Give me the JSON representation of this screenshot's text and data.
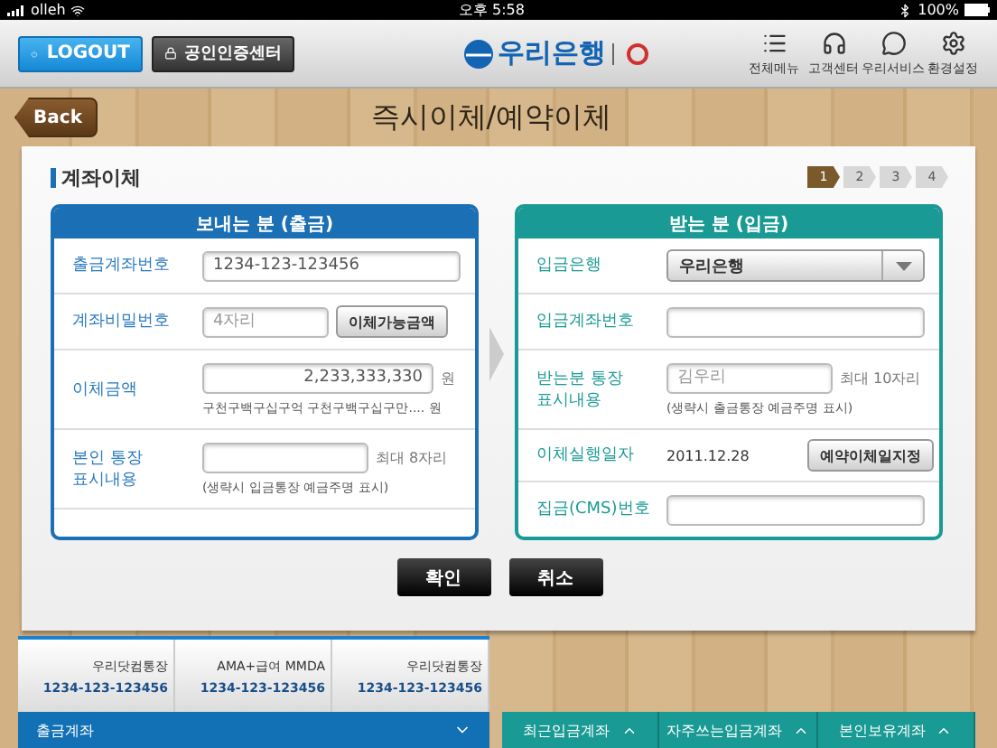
{
  "status_bar": {
    "carrier": "olleh",
    "time": "오후 5:58",
    "battery": "100%"
  },
  "header": {
    "logout": "LOGOUT",
    "certificate": "공인인증센터",
    "logo": "우리은행",
    "menu": [
      {
        "kind": "list",
        "label": "전체메뉴"
      },
      {
        "kind": "headset",
        "label": "고객센터"
      },
      {
        "kind": "chat",
        "label": "우리서비스"
      },
      {
        "kind": "gear",
        "label": "환경설정"
      }
    ]
  },
  "page": {
    "back": "Back",
    "title": "즉시이체/예약이체"
  },
  "section_title": "계좌이체",
  "steps": [
    {
      "label": "1",
      "selected": true
    },
    {
      "label": "2",
      "selected": false
    },
    {
      "label": "3",
      "selected": false
    },
    {
      "label": "4",
      "selected": false
    }
  ],
  "sender": {
    "title": "보내는 분 (출금)",
    "rows": [
      {
        "kind": "input",
        "label": "출금계좌번호",
        "value": "1234-123-123456"
      },
      {
        "kind": "input_button",
        "label": "계좌비밀번호",
        "placeholder": "4자리",
        "button": "이체가능금액"
      },
      {
        "kind": "amount",
        "label": "이체금액",
        "value": "2,233,333,330",
        "unit": "원",
        "note": "구천구백구십구억 구천구백구십구만.... 원"
      },
      {
        "kind": "input_note",
        "label": "본인 통장 표시내용",
        "hint": "최대 8자리",
        "note": "(생략시 입금통장 예금주명 표시)"
      }
    ]
  },
  "receiver": {
    "title": "받는 분 (입금)",
    "rows": [
      {
        "kind": "select",
        "label": "입금은행",
        "value": "우리은행"
      },
      {
        "kind": "input",
        "label": "입금계좌번호"
      },
      {
        "kind": "input_note",
        "label": "받는분 통장 표시내용",
        "placeholder": "김우리",
        "hint": "최대 10자리",
        "note": "(생략시 출금통장 예금주명 표시)"
      },
      {
        "kind": "text_button",
        "label": "이체실행일자",
        "value": "2011.12.28",
        "button": "예약이체일지정"
      },
      {
        "kind": "input",
        "label": "집금(CMS)번호"
      }
    ]
  },
  "actions": [
    "확인",
    "취소"
  ],
  "accounts": {
    "items": [
      {
        "name": "우리닷컴통장",
        "number": "1234-123-123456"
      },
      {
        "name": "AMA+급여 MMDA",
        "number": "1234-123-123456"
      },
      {
        "name": "우리닷컴통장",
        "number": "1234-123-123456"
      }
    ],
    "tab": "출금계좌"
  },
  "account_tabs": [
    "최근입금계좌",
    "자주쓰는입금계좌",
    "본인보유계좌"
  ]
}
